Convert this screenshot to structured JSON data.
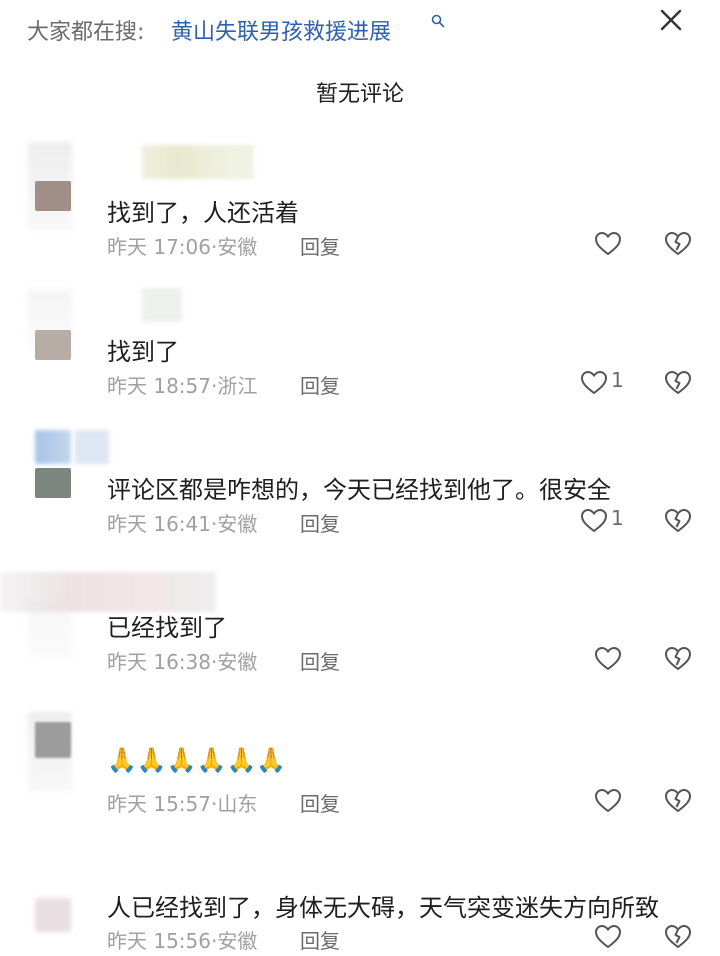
{
  "search": {
    "prefix": "大家都在搜:",
    "term": "黄山失联男孩救援进展"
  },
  "header": {
    "title": "暂无评论"
  },
  "comments": [
    {
      "text": "找到了，人还活着",
      "time": "昨天 17:06",
      "location": "安徽",
      "reply": "回复",
      "likes": "",
      "avatar_color": "#a08f86"
    },
    {
      "text": "找到了",
      "time": "昨天 18:57",
      "location": "浙江",
      "reply": "回复",
      "likes": "1",
      "avatar_color": "#b7aca6"
    },
    {
      "text": "评论区都是咋想的，今天已经找到他了。很安全",
      "time": "昨天 16:41",
      "location": "安徽",
      "reply": "回复",
      "likes": "1",
      "avatar_color": "#7d857f"
    },
    {
      "text": "已经找到了",
      "time": "昨天 16:38",
      "location": "安徽",
      "reply": "回复",
      "likes": "",
      "avatar_color": "#dfe3e3"
    },
    {
      "text": "🙏🙏🙏🙏🙏🙏",
      "time": "昨天 15:57",
      "location": "山东",
      "reply": "回复",
      "likes": "",
      "avatar_color": "#9c9c9c"
    },
    {
      "text": "人已经找到了，身体无大碍，天气突变迷失方向所致",
      "time": "昨天 15:56",
      "location": "安徽",
      "reply": "回复",
      "likes": "",
      "avatar_color": "#e9dfe3"
    }
  ],
  "colors": {
    "link_blue": "#2f5fae",
    "meta_gray": "#a0a0a0",
    "icon_gray": "#6b6b6b"
  }
}
